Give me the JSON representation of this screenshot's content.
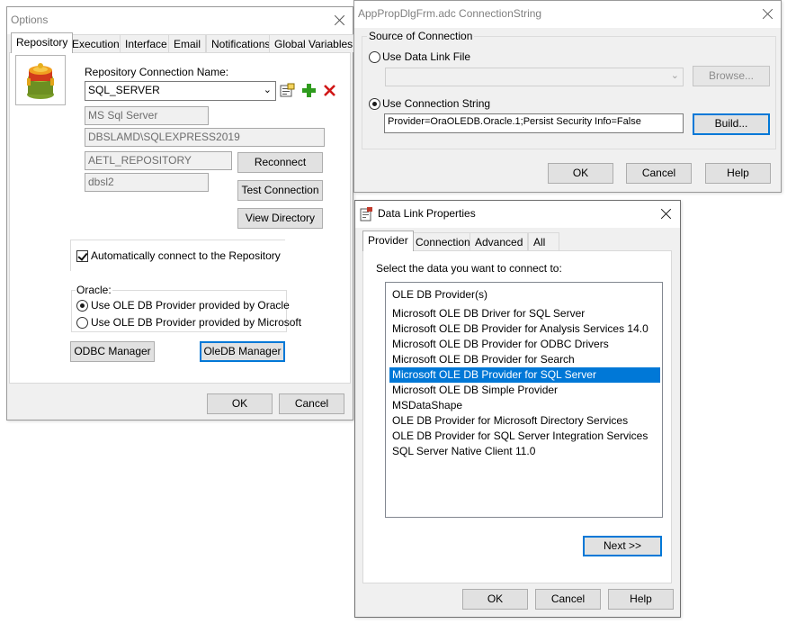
{
  "options_dialog": {
    "title": "Options",
    "tabs": [
      "Repository",
      "Execution",
      "Interface",
      "Email",
      "Notifications",
      "Global Variables"
    ],
    "repository_connection_label": "Repository Connection Name:",
    "connection_name_value": "SQL_SERVER",
    "server_type_value": "MS Sql Server",
    "server_name_value": "DBSLAMD\\SQLEXPRESS2019",
    "database_value": "AETL_REPOSITORY",
    "user_value": "dbsl2",
    "reconnect_label": "Reconnect",
    "test_connection_label": "Test Connection",
    "view_directory_label": "View Directory",
    "auto_connect_label": "Automatically connect to the Repository",
    "oracle_group_label": "Oracle:",
    "oracle_option_1": "Use OLE DB Provider provided by Oracle",
    "oracle_option_2": "Use OLE DB Provider provided by Microsoft",
    "odbc_manager_label": "ODBC Manager",
    "oledb_manager_label": "OleDB Manager",
    "ok_label": "OK",
    "cancel_label": "Cancel"
  },
  "connstr_dialog": {
    "title": "AppPropDlgFrm.adc ConnectionString",
    "group_label": "Source of Connection",
    "data_link_file_label": "Use Data Link File",
    "browse_label": "Browse...",
    "connection_string_label": "Use Connection String",
    "connection_string_value": "Provider=OraOLEDB.Oracle.1;Persist Security Info=False",
    "build_label": "Build...",
    "ok_label": "OK",
    "cancel_label": "Cancel",
    "help_label": "Help"
  },
  "datalink_dialog": {
    "title": "Data Link Properties",
    "tabs": [
      "Provider",
      "Connection",
      "Advanced",
      "All"
    ],
    "instruction": "Select the data you want to connect to:",
    "providers": [
      "OLE DB Provider(s)",
      "Microsoft OLE DB Driver for SQL Server",
      "Microsoft OLE DB Provider for Analysis Services 14.0",
      "Microsoft OLE DB Provider for ODBC Drivers",
      "Microsoft OLE DB Provider for Search",
      "Microsoft OLE DB Provider for SQL Server",
      "Microsoft OLE DB Simple Provider",
      "MSDataShape",
      "OLE DB Provider for Microsoft Directory Services",
      "OLE DB Provider for SQL Server Integration Services",
      "SQL Server Native Client 11.0"
    ],
    "selected_provider": "Microsoft OLE DB Provider for SQL Server",
    "next_label": "Next >>",
    "ok_label": "OK",
    "cancel_label": "Cancel",
    "help_label": "Help"
  },
  "colors": {
    "selection": "#0078d7",
    "delete_red": "#d01616",
    "add_green": "#2e9b1d"
  }
}
